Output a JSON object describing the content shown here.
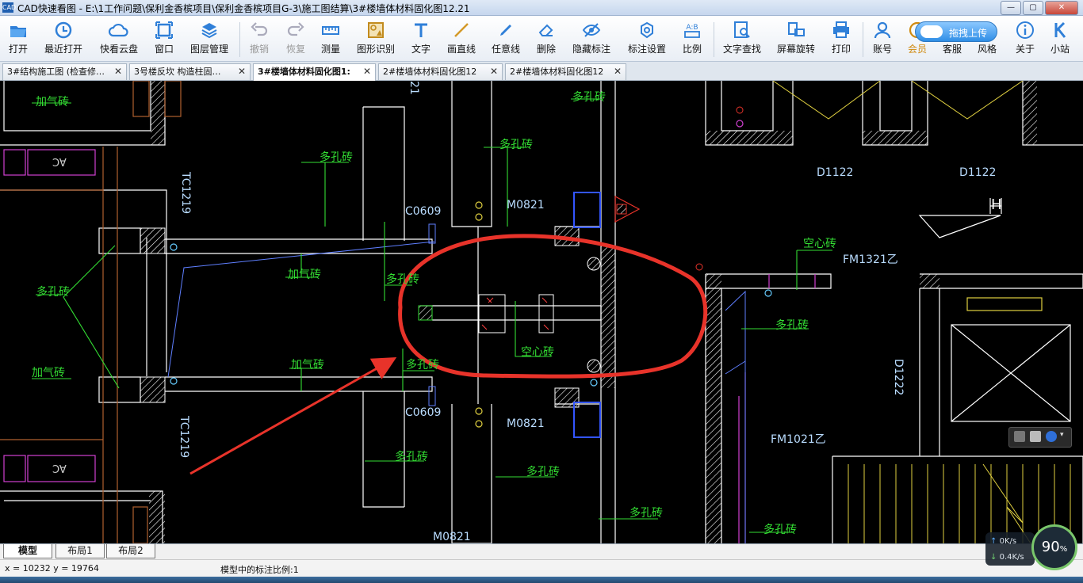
{
  "window": {
    "title": "CAD快速看图 - E:\\1工作问题\\保利金香槟项目\\保利金香槟项目G-3\\施工图结算\\3#楼墙体材料固化图12.21",
    "icon": "cad-app-icon",
    "buttons": [
      "minimize",
      "maximize",
      "close"
    ]
  },
  "toolbar": {
    "open": "打开",
    "recent": "最近打开",
    "cloud": "快看云盘",
    "window": "窗口",
    "layers": "图层管理",
    "undo": "撤销",
    "redo": "恢复",
    "measure": "测量",
    "recognize": "图形识别",
    "text": "文字",
    "line": "画直线",
    "freeline": "任意线",
    "erase": "删除",
    "hide_marks": "隐藏标注",
    "mark_settings": "标注设置",
    "scale": "比例",
    "text_search": "文字查找",
    "rotate_screen": "屏幕旋转",
    "print": "打印",
    "account": "账号",
    "vip": "会员",
    "service": "客服",
    "style": "风格",
    "about": "关于",
    "station": "小站",
    "upload": "拖拽上传",
    "scale_icon_text": "A:B"
  },
  "tabs": [
    {
      "label": "3#结构施工图 (检查修…",
      "active": false
    },
    {
      "label": "3号楼反坎  构造柱固…",
      "active": false
    },
    {
      "label": "3#楼墙体材料固化图1:",
      "active": true
    },
    {
      "label": "2#楼墙体材料固化图12",
      "active": false
    },
    {
      "label": "2#楼墙体材料固化图12",
      "active": false
    }
  ],
  "drawing": {
    "labels": {
      "jqz1": "加气砖",
      "jqz2": "加气砖",
      "jqz3": "加气砖",
      "jqz4": "加气砖",
      "dkz1": "多孔砖",
      "dkz2": "多孔砖",
      "dkz3": "多孔砖",
      "dkz4": "多孔砖",
      "dkz5": "多孔砖",
      "dkz6": "多孔砖",
      "dkz7": "多孔砖",
      "dkz8": "多孔砖",
      "dkz9": "多孔砖",
      "dkz10": "多孔砖",
      "dkz11": "多孔砖",
      "kxz1": "空心砖",
      "kxz2": "空心砖",
      "c0609a": "C0609",
      "c0609b": "C0609",
      "m0821a": "M0821",
      "m0821b": "M0821",
      "m0821c": "M0821",
      "tc1219a": "TC1219",
      "tc1219b": "TC1219",
      "d1122a": "D1122",
      "d1122b": "D1122",
      "d1222": "D1222",
      "fm1321": "FM1321乙",
      "fm1021": "FM1021乙",
      "h_mark": "H",
      "num21": "21",
      "ac1": "AC",
      "ac2": "AC"
    },
    "highlight_color": "#e8332a",
    "line_green": "#33dd33",
    "line_white": "#ffffff",
    "line_blue": "#3355ff"
  },
  "layout_tabs": [
    "模型",
    "布局1",
    "布局2"
  ],
  "status": {
    "coords": "x = 10232  y = 19764",
    "scale_text": "模型中的标注比例:1"
  },
  "netspeed": {
    "up": "0K/s",
    "down": "0.4K/s",
    "percent": "90",
    "unit": "%"
  }
}
